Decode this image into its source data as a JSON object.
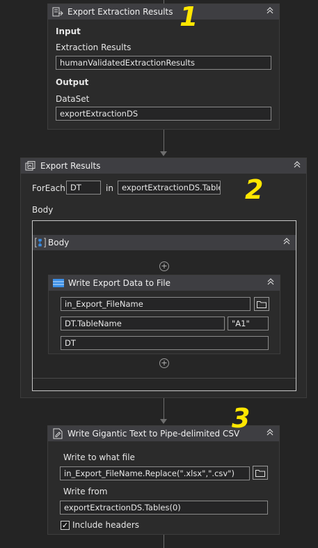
{
  "activity1": {
    "title": "Export Extraction Results",
    "input_header": "Input",
    "input_label": "Extraction Results",
    "input_value": "humanValidatedExtractionResults",
    "output_header": "Output",
    "output_label": "DataSet",
    "output_value": "exportExtractionDS"
  },
  "activity2": {
    "title": "Export Results",
    "foreach_label": "ForEach",
    "item_value": "DT",
    "in_label": "in",
    "collection_value": "exportExtractionDS.Tables",
    "body_label": "Body",
    "body_sequence_title": "Body",
    "write_activity": {
      "title": "Write Export Data to File",
      "filename_value": "in_Export_FileName",
      "sheet_value": "DT.TableName",
      "cell_value": "\"A1\"",
      "data_value": "DT"
    }
  },
  "activity3": {
    "title": "Write Gigantic Text to Pipe-delimited CSV",
    "file_label": "Write to what file",
    "file_value": "in_Export_FileName.Replace(\".xlsx\",\".csv\")",
    "from_label": "Write from",
    "from_value": "exportExtractionDS.Tables(0)",
    "include_headers_label": "Include headers",
    "include_headers_checked": true
  },
  "annotations": {
    "one": "1",
    "two": "2",
    "three": "3"
  },
  "icons": {
    "export_icon": "export-icon",
    "foreach_icon": "foreach-icon",
    "sequence_icon": "sequence-icon",
    "table_icon": "table-icon",
    "file_write_icon": "file-write-icon",
    "collapse_icon": "double-chevron-up-icon",
    "folder_icon": "folder-icon",
    "plus_icon": "plus-circle-icon"
  },
  "colors": {
    "background": "#242424",
    "header": "#3e3e42",
    "annotation": "#ffe600",
    "accent_blue": "#3a8ee6"
  }
}
